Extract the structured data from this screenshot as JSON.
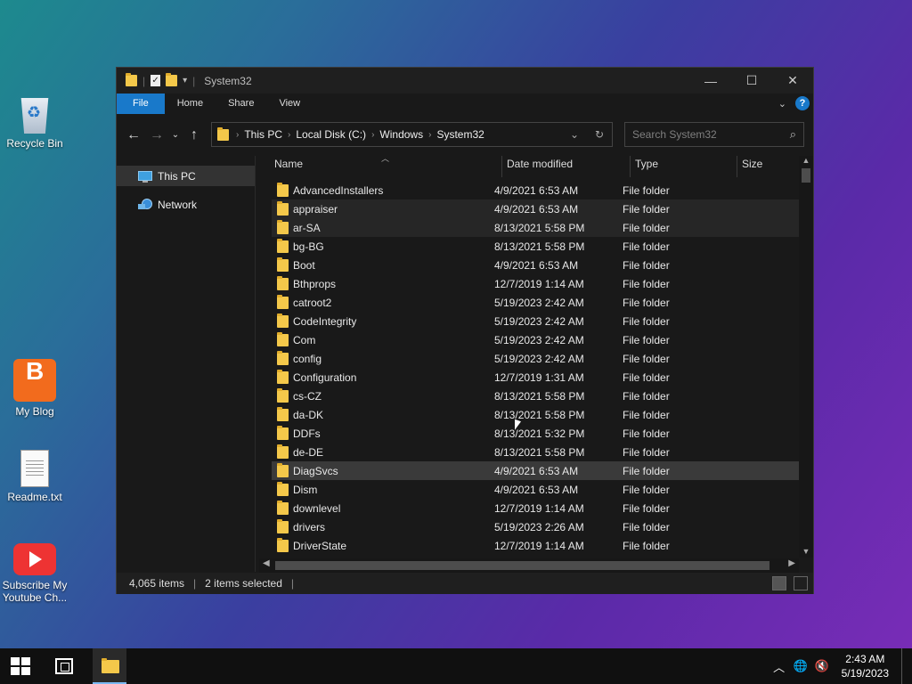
{
  "desktop": {
    "icons": [
      {
        "label": "Recycle Bin",
        "icon": "recycle-bin-icon"
      },
      {
        "label": "My Blog",
        "icon": "blogger-icon"
      },
      {
        "label": "Readme.txt",
        "icon": "text-file-icon"
      },
      {
        "label": "Subscribe My Youtube Ch...",
        "icon": "youtube-icon"
      }
    ]
  },
  "window": {
    "title": "System32",
    "ribbon_tabs": [
      "File",
      "Home",
      "Share",
      "View"
    ],
    "breadcrumb": [
      "This PC",
      "Local Disk (C:)",
      "Windows",
      "System32"
    ],
    "search_placeholder": "Search System32",
    "nav_pane": [
      "This PC",
      "Network"
    ],
    "columns": [
      "Name",
      "Date modified",
      "Type",
      "Size"
    ],
    "files": [
      {
        "name": "AdvancedInstallers",
        "date": "4/9/2021 6:53 AM",
        "type": "File folder"
      },
      {
        "name": "appraiser",
        "date": "4/9/2021 6:53 AM",
        "type": "File folder",
        "state": "hover"
      },
      {
        "name": "ar-SA",
        "date": "8/13/2021 5:58 PM",
        "type": "File folder",
        "state": "hover"
      },
      {
        "name": "bg-BG",
        "date": "8/13/2021 5:58 PM",
        "type": "File folder"
      },
      {
        "name": "Boot",
        "date": "4/9/2021 6:53 AM",
        "type": "File folder"
      },
      {
        "name": "Bthprops",
        "date": "12/7/2019 1:14 AM",
        "type": "File folder"
      },
      {
        "name": "catroot2",
        "date": "5/19/2023 2:42 AM",
        "type": "File folder"
      },
      {
        "name": "CodeIntegrity",
        "date": "5/19/2023 2:42 AM",
        "type": "File folder"
      },
      {
        "name": "Com",
        "date": "5/19/2023 2:42 AM",
        "type": "File folder"
      },
      {
        "name": "config",
        "date": "5/19/2023 2:42 AM",
        "type": "File folder"
      },
      {
        "name": "Configuration",
        "date": "12/7/2019 1:31 AM",
        "type": "File folder"
      },
      {
        "name": "cs-CZ",
        "date": "8/13/2021 5:58 PM",
        "type": "File folder"
      },
      {
        "name": "da-DK",
        "date": "8/13/2021 5:58 PM",
        "type": "File folder"
      },
      {
        "name": "DDFs",
        "date": "8/13/2021 5:32 PM",
        "type": "File folder"
      },
      {
        "name": "de-DE",
        "date": "8/13/2021 5:58 PM",
        "type": "File folder"
      },
      {
        "name": "DiagSvcs",
        "date": "4/9/2021 6:53 AM",
        "type": "File folder",
        "state": "selected"
      },
      {
        "name": "Dism",
        "date": "4/9/2021 6:53 AM",
        "type": "File folder"
      },
      {
        "name": "downlevel",
        "date": "12/7/2019 1:14 AM",
        "type": "File folder"
      },
      {
        "name": "drivers",
        "date": "5/19/2023 2:26 AM",
        "type": "File folder"
      },
      {
        "name": "DriverState",
        "date": "12/7/2019 1:14 AM",
        "type": "File folder"
      }
    ],
    "status": {
      "item_count": "4,065 items",
      "selected": "2 items selected"
    }
  },
  "taskbar": {
    "time": "2:43 AM",
    "date": "5/19/2023"
  },
  "colors": {
    "accent": "#1979ca",
    "folder": "#f4c84a",
    "window_bg": "#191919"
  }
}
